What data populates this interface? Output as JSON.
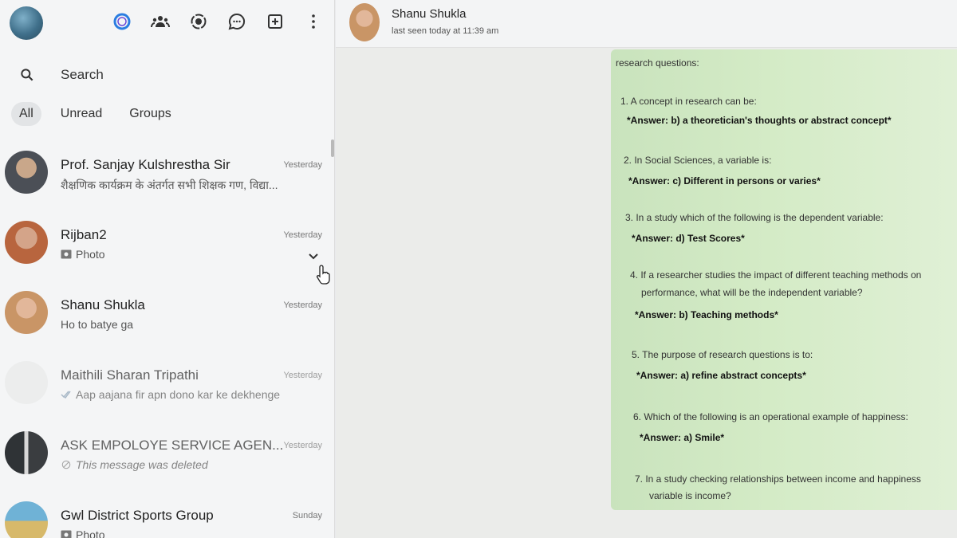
{
  "sidebar": {
    "search_placeholder": "Search",
    "filters": [
      "All",
      "Unread",
      "Groups"
    ],
    "chats": [
      {
        "name": "Prof. Sanjay Kulshrestha Sir",
        "time": "Yesterday",
        "preview": "शैक्षणिक कार्यक्रम के अंतर्गत सभी शिक्षक गण, विद्या..."
      },
      {
        "name": "Rijban2",
        "time": "Yesterday",
        "preview": "Photo"
      },
      {
        "name": "Shanu Shukla",
        "time": "Yesterday",
        "preview": "Ho to batye  ga"
      },
      {
        "name": "Maithili Sharan Tripathi",
        "time": "Yesterday",
        "preview": "Aap aajana fir apn dono kar ke dekhenge"
      },
      {
        "name": "ASK EMPOLOYE SERVICE AGEN...",
        "time": "Yesterday",
        "preview": "This message was deleted"
      },
      {
        "name": "Gwl District Sports Group",
        "time": "Sunday",
        "preview": "Photo"
      }
    ]
  },
  "chat": {
    "name": "Shanu Shukla",
    "status": "last seen today at 11:39 am",
    "message": {
      "heading": "research questions:",
      "items": [
        {
          "q": "1. A concept in research can be:",
          "a": "*Answer: b) a theoretician's thoughts or abstract concept*"
        },
        {
          "q": "2. In Social Sciences, a variable is:",
          "a": "*Answer: c) Different in persons or varies*"
        },
        {
          "q": "3. In a study which of the following is the dependent variable:",
          "a": "*Answer: d) Test Scores*"
        },
        {
          "q": "4. If a researcher studies the impact of different teaching methods on",
          "q2": "performance, what will be the independent variable?",
          "a": "*Answer: b) Teaching methods*"
        },
        {
          "q": "5. The purpose of research questions is to:",
          "a": "*Answer: a) refine abstract concepts*"
        },
        {
          "q": "6. Which of the following is an operational example of happiness:",
          "a": "*Answer: a) Smile*"
        },
        {
          "q": "7. In a study checking relationships between income and happiness",
          "q2": "variable is income?"
        }
      ]
    }
  },
  "colors": {
    "bubble": "#d4ebc6",
    "sidebar_bg": "#f4f5f6",
    "conversation_bg": "#ebecea"
  }
}
